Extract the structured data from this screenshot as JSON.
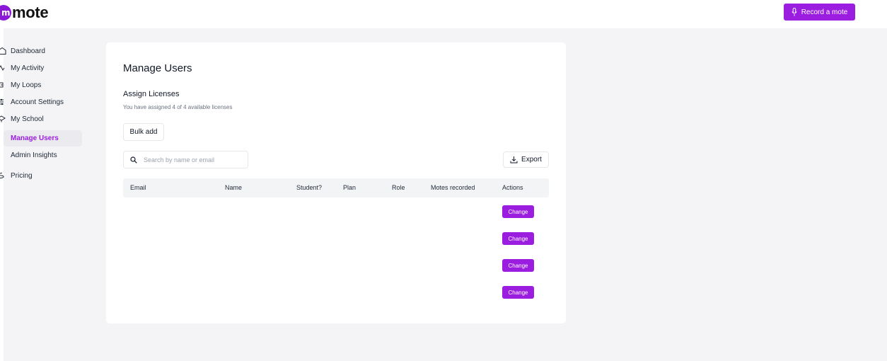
{
  "app": {
    "name": "mote"
  },
  "header": {
    "record_label": "Record a mote"
  },
  "sidebar": {
    "items": [
      {
        "label": "Dashboard",
        "icon": "dashboard-icon"
      },
      {
        "label": "My Activity",
        "icon": "activity-icon"
      },
      {
        "label": "My Loops",
        "icon": "loops-icon"
      },
      {
        "label": "Account Settings",
        "icon": "settings-icon"
      },
      {
        "label": "My School",
        "icon": "school-icon"
      }
    ],
    "subitems": [
      {
        "label": "Manage Users",
        "active": true
      },
      {
        "label": "Admin Insights",
        "active": false
      }
    ],
    "pricing": {
      "label": "Pricing",
      "icon": "pricing-icon"
    }
  },
  "main": {
    "title": "Manage Users",
    "section_title": "Assign Licenses",
    "section_subtitle": "You have assigned 4 of 4 available licenses",
    "bulk_add_label": "Bulk add",
    "search_placeholder": "Search by name or email",
    "export_label": "Export",
    "table": {
      "columns": [
        "Email",
        "Name",
        "Student?",
        "Plan",
        "Role",
        "Motes recorded",
        "Actions"
      ],
      "rows": [
        {
          "action_label": "Change"
        },
        {
          "action_label": "Change"
        },
        {
          "action_label": "Change"
        },
        {
          "action_label": "Change"
        }
      ]
    }
  },
  "colors": {
    "accent": "#9b1de0",
    "background": "#f4f4f6",
    "card": "#ffffff"
  }
}
